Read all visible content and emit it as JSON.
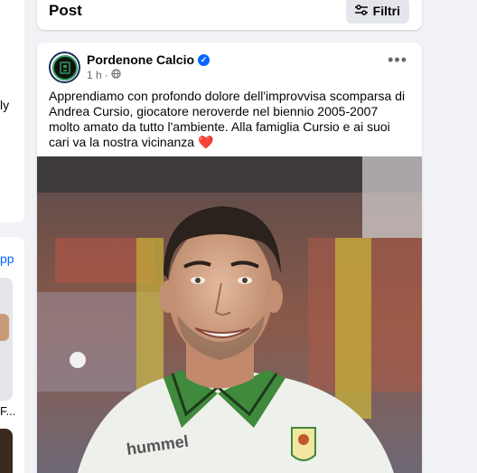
{
  "left_column": {
    "fragment_top": "ly",
    "link_fragment": "pp",
    "fragment_bottom": "F..."
  },
  "header": {
    "title": "Post",
    "filter_label": "Filtri",
    "filter_icon": "sliders-icon"
  },
  "post": {
    "page_name": "Pordenone Calcio",
    "verified_icon": "verified-badge-icon",
    "time": "1 h",
    "separator": "·",
    "privacy_icon": "globe-icon",
    "more_icon": "more-horizontal-icon",
    "more_label": "•••",
    "text": "Apprendiamo con profondo dolore dell'improvvisa scomparsa di Andrea Cursio, giocatore neroverde nel biennio 2005-2007 molto amato da tutto l'ambiente. Alla famiglia Cursio e ai suoi cari va la nostra vicinanza",
    "emoji": "❤️",
    "photo_brand_text": "hummel"
  },
  "colors": {
    "background": "#f0f2f5",
    "card": "#ffffff",
    "accent_blue": "#0866ff",
    "club_green": "#2e9b5a",
    "secondary_text": "#65676b"
  }
}
